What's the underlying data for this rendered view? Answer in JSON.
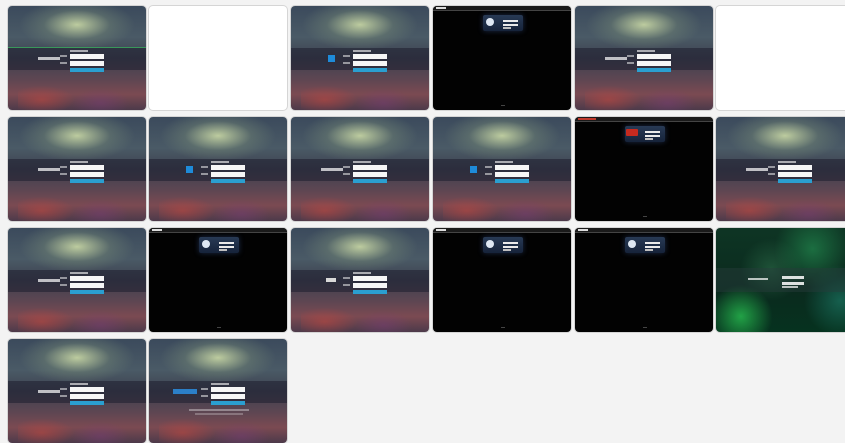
{
  "gallery": {
    "thumbnails": [
      {
        "theme": "gradient",
        "variant": "strip"
      },
      {
        "theme": "blank"
      },
      {
        "theme": "gradient",
        "variant": "logo"
      },
      {
        "theme": "dark",
        "variant": "round"
      },
      {
        "theme": "gradient",
        "variant": "plain"
      },
      {
        "theme": "blank"
      },
      {
        "theme": "gradient",
        "variant": "plain"
      },
      {
        "theme": "gradient",
        "variant": "logo"
      },
      {
        "theme": "gradient",
        "variant": "plain"
      },
      {
        "theme": "gradient",
        "variant": "logo"
      },
      {
        "theme": "dark",
        "variant": "red"
      },
      {
        "theme": "gradient",
        "variant": "plain"
      },
      {
        "theme": "gradient",
        "variant": "plain"
      },
      {
        "theme": "dark",
        "variant": "round"
      },
      {
        "theme": "gradient",
        "variant": "pill"
      },
      {
        "theme": "dark",
        "variant": "round"
      },
      {
        "theme": "dark",
        "variant": "round"
      },
      {
        "theme": "green",
        "variant": "plain"
      },
      {
        "theme": "gradient",
        "variant": "plain"
      },
      {
        "theme": "gradient",
        "variant": "footer"
      }
    ]
  },
  "colors": {
    "page_background": "#f3f3f3",
    "login_button": "#2a9fd0",
    "dark_panel": "#283a55",
    "red_logo": "#c62a1f",
    "green_accent": "#28be50"
  }
}
